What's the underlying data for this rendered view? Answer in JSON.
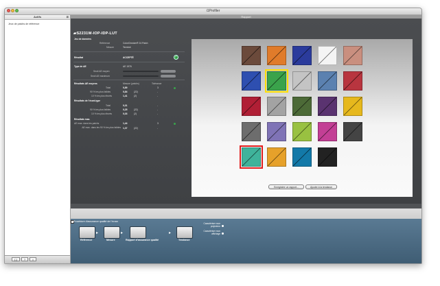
{
  "window": {
    "title": "i1Profiler",
    "content_title": "Rapport"
  },
  "sidebar": {
    "header": "Actifs",
    "items": [
      {
        "label": "Jeux de patchs de référence"
      }
    ],
    "footer_buttons": [
      "[-]",
      "?",
      "⌂"
    ]
  },
  "report": {
    "device_name": "S2231W-IOP-IDP-LUT",
    "dataset_heading": "Jeu de données",
    "reference_label": "Référence",
    "reference_value": "ColorChecker® 24 Patch",
    "measure_label": "Mesure",
    "measure_value": "Terminé",
    "result_label": "Résultat",
    "result_value": "ACCEPTÉ",
    "de_type_label": "Type de ΔE",
    "de_type_value": "ΔE 1976",
    "threshold_avg_label": "Seuil ΔE moyen",
    "threshold_max_label": "Seuil ΔE maximum",
    "avg_heading": "Résultats ΔE moyens",
    "col_measure": "Mesure (patchs)",
    "col_tolerance": "Tolérance",
    "avg_rows": [
      {
        "label": "Total",
        "value": "0,89",
        "count": "",
        "tol": "3"
      },
      {
        "label": "90 % les plus faibles",
        "value": "0,84",
        "count": "(22)",
        "tol": "-"
      },
      {
        "label": "10 % les plus élevés",
        "value": "1,41",
        "count": "(2)",
        "tol": "-"
      }
    ],
    "std_heading": "Résultats de l'écart-type",
    "std_rows": [
      {
        "label": "Total",
        "value": "0,31",
        "count": "",
        "tol": "-"
      },
      {
        "label": "90 % les plus faibles",
        "value": "0,25",
        "count": "(22)",
        "tol": "-"
      },
      {
        "label": "10 % les plus élevés",
        "value": "0,03",
        "count": "(2)",
        "tol": "-"
      }
    ],
    "max_heading": "Résultats max.",
    "max_rows": [
      {
        "label": "ΔE max. dans les patchs",
        "value": "1,44",
        "count": "",
        "tol": "3"
      },
      {
        "label": "ΔE max. dans les 90 % les plus faibles",
        "value": "1,37",
        "count": "(22)",
        "tol": "-"
      }
    ],
    "buttons": {
      "save": "Enregistrer un rapport...",
      "trend": "Ajouter à la tendance"
    }
  },
  "patches": [
    {
      "color": "#6b4a3b",
      "hl": ""
    },
    {
      "color": "#e07b2a",
      "hl": ""
    },
    {
      "color": "#2b3b9c",
      "hl": ""
    },
    {
      "color": "#f4f4f4",
      "hl": ""
    },
    {
      "color": "#c98f7f",
      "hl": ""
    },
    {
      "color": "#2e4fb0",
      "hl": ""
    },
    {
      "color": "#3aa34b",
      "hl": "yellow"
    },
    {
      "color": "#c4c4c4",
      "hl": ""
    },
    {
      "color": "#5b81b0",
      "hl": ""
    },
    {
      "color": "#b8353f",
      "hl": ""
    },
    {
      "color": "#b01f35",
      "hl": ""
    },
    {
      "color": "#a3a3a3",
      "hl": ""
    },
    {
      "color": "#4c6a37",
      "hl": ""
    },
    {
      "color": "#5a3370",
      "hl": ""
    },
    {
      "color": "#e6b81d",
      "hl": ""
    },
    {
      "color": "#6d6d6d",
      "hl": ""
    },
    {
      "color": "#7f73b6",
      "hl": ""
    },
    {
      "color": "#99c141",
      "hl": ""
    },
    {
      "color": "#c33f95",
      "hl": ""
    },
    {
      "color": "#444444",
      "hl": ""
    },
    {
      "color": "#3fb39b",
      "hl": "red"
    },
    {
      "color": "#e6a12a",
      "hl": ""
    },
    {
      "color": "#1379a8",
      "hl": ""
    },
    {
      "color": "#222222",
      "hl": ""
    }
  ],
  "procedure": {
    "title": "Procédure d'assurance qualité de l'écran",
    "steps": [
      "Référence",
      "Mesure",
      "Rapport d'assurance qualité",
      "Tendance"
    ],
    "options": [
      "Caractériser mon projecteur",
      "Caractériser mon affichage"
    ]
  }
}
